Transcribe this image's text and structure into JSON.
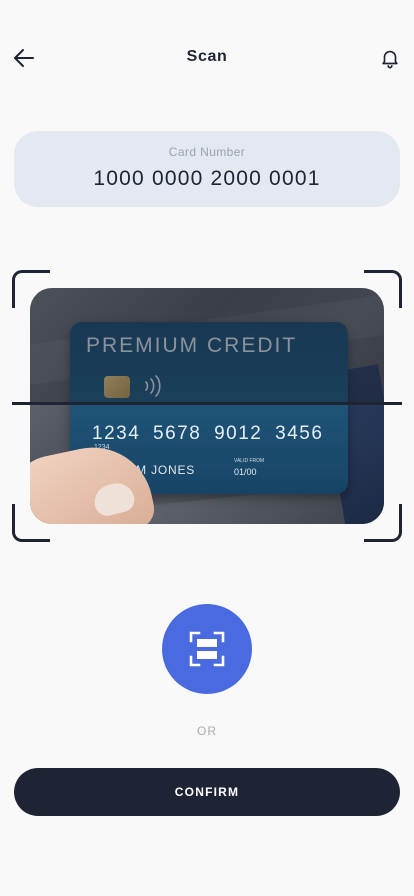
{
  "header": {
    "title": "Scan",
    "back_icon": "arrow-left-icon",
    "notification_icon": "bell-icon"
  },
  "card_number": {
    "label": "Card Number",
    "value": "1000 0000 2000 0001"
  },
  "scanned_card": {
    "title": "PREMIUM CREDIT",
    "number": "1234 5678 9012 3456",
    "small_number": "1234",
    "holder": "WILLIAM JONES",
    "valid_label": "VALID FROM",
    "valid_date": "01/00"
  },
  "scan_button": {
    "icon": "scan-frame-icon"
  },
  "or_text": "OR",
  "confirm_label": "CONFIRM",
  "colors": {
    "primary_dark": "#1e2433",
    "accent_blue": "#4a6ae0",
    "card_field_bg": "#e3e8f1",
    "background": "#f9f9fa"
  }
}
